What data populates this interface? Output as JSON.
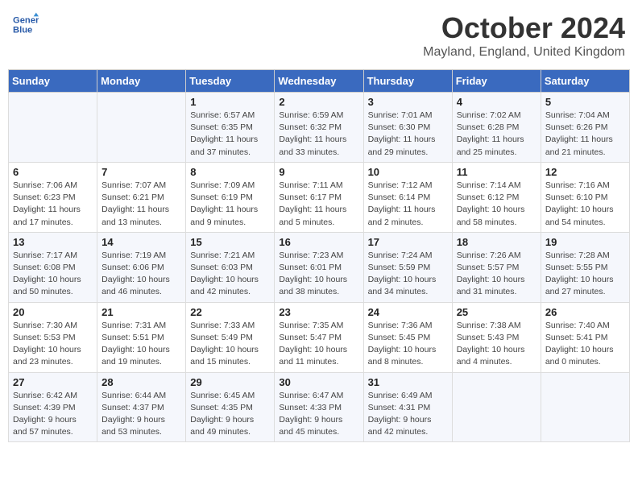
{
  "header": {
    "logo_line1": "General",
    "logo_line2": "Blue",
    "month_title": "October 2024",
    "location": "Mayland, England, United Kingdom"
  },
  "weekdays": [
    "Sunday",
    "Monday",
    "Tuesday",
    "Wednesday",
    "Thursday",
    "Friday",
    "Saturday"
  ],
  "weeks": [
    [
      {
        "day": "",
        "info": ""
      },
      {
        "day": "",
        "info": ""
      },
      {
        "day": "1",
        "info": "Sunrise: 6:57 AM\nSunset: 6:35 PM\nDaylight: 11 hours and 37 minutes."
      },
      {
        "day": "2",
        "info": "Sunrise: 6:59 AM\nSunset: 6:32 PM\nDaylight: 11 hours and 33 minutes."
      },
      {
        "day": "3",
        "info": "Sunrise: 7:01 AM\nSunset: 6:30 PM\nDaylight: 11 hours and 29 minutes."
      },
      {
        "day": "4",
        "info": "Sunrise: 7:02 AM\nSunset: 6:28 PM\nDaylight: 11 hours and 25 minutes."
      },
      {
        "day": "5",
        "info": "Sunrise: 7:04 AM\nSunset: 6:26 PM\nDaylight: 11 hours and 21 minutes."
      }
    ],
    [
      {
        "day": "6",
        "info": "Sunrise: 7:06 AM\nSunset: 6:23 PM\nDaylight: 11 hours and 17 minutes."
      },
      {
        "day": "7",
        "info": "Sunrise: 7:07 AM\nSunset: 6:21 PM\nDaylight: 11 hours and 13 minutes."
      },
      {
        "day": "8",
        "info": "Sunrise: 7:09 AM\nSunset: 6:19 PM\nDaylight: 11 hours and 9 minutes."
      },
      {
        "day": "9",
        "info": "Sunrise: 7:11 AM\nSunset: 6:17 PM\nDaylight: 11 hours and 5 minutes."
      },
      {
        "day": "10",
        "info": "Sunrise: 7:12 AM\nSunset: 6:14 PM\nDaylight: 11 hours and 2 minutes."
      },
      {
        "day": "11",
        "info": "Sunrise: 7:14 AM\nSunset: 6:12 PM\nDaylight: 10 hours and 58 minutes."
      },
      {
        "day": "12",
        "info": "Sunrise: 7:16 AM\nSunset: 6:10 PM\nDaylight: 10 hours and 54 minutes."
      }
    ],
    [
      {
        "day": "13",
        "info": "Sunrise: 7:17 AM\nSunset: 6:08 PM\nDaylight: 10 hours and 50 minutes."
      },
      {
        "day": "14",
        "info": "Sunrise: 7:19 AM\nSunset: 6:06 PM\nDaylight: 10 hours and 46 minutes."
      },
      {
        "day": "15",
        "info": "Sunrise: 7:21 AM\nSunset: 6:03 PM\nDaylight: 10 hours and 42 minutes."
      },
      {
        "day": "16",
        "info": "Sunrise: 7:23 AM\nSunset: 6:01 PM\nDaylight: 10 hours and 38 minutes."
      },
      {
        "day": "17",
        "info": "Sunrise: 7:24 AM\nSunset: 5:59 PM\nDaylight: 10 hours and 34 minutes."
      },
      {
        "day": "18",
        "info": "Sunrise: 7:26 AM\nSunset: 5:57 PM\nDaylight: 10 hours and 31 minutes."
      },
      {
        "day": "19",
        "info": "Sunrise: 7:28 AM\nSunset: 5:55 PM\nDaylight: 10 hours and 27 minutes."
      }
    ],
    [
      {
        "day": "20",
        "info": "Sunrise: 7:30 AM\nSunset: 5:53 PM\nDaylight: 10 hours and 23 minutes."
      },
      {
        "day": "21",
        "info": "Sunrise: 7:31 AM\nSunset: 5:51 PM\nDaylight: 10 hours and 19 minutes."
      },
      {
        "day": "22",
        "info": "Sunrise: 7:33 AM\nSunset: 5:49 PM\nDaylight: 10 hours and 15 minutes."
      },
      {
        "day": "23",
        "info": "Sunrise: 7:35 AM\nSunset: 5:47 PM\nDaylight: 10 hours and 11 minutes."
      },
      {
        "day": "24",
        "info": "Sunrise: 7:36 AM\nSunset: 5:45 PM\nDaylight: 10 hours and 8 minutes."
      },
      {
        "day": "25",
        "info": "Sunrise: 7:38 AM\nSunset: 5:43 PM\nDaylight: 10 hours and 4 minutes."
      },
      {
        "day": "26",
        "info": "Sunrise: 7:40 AM\nSunset: 5:41 PM\nDaylight: 10 hours and 0 minutes."
      }
    ],
    [
      {
        "day": "27",
        "info": "Sunrise: 6:42 AM\nSunset: 4:39 PM\nDaylight: 9 hours and 57 minutes."
      },
      {
        "day": "28",
        "info": "Sunrise: 6:44 AM\nSunset: 4:37 PM\nDaylight: 9 hours and 53 minutes."
      },
      {
        "day": "29",
        "info": "Sunrise: 6:45 AM\nSunset: 4:35 PM\nDaylight: 9 hours and 49 minutes."
      },
      {
        "day": "30",
        "info": "Sunrise: 6:47 AM\nSunset: 4:33 PM\nDaylight: 9 hours and 45 minutes."
      },
      {
        "day": "31",
        "info": "Sunrise: 6:49 AM\nSunset: 4:31 PM\nDaylight: 9 hours and 42 minutes."
      },
      {
        "day": "",
        "info": ""
      },
      {
        "day": "",
        "info": ""
      }
    ]
  ]
}
